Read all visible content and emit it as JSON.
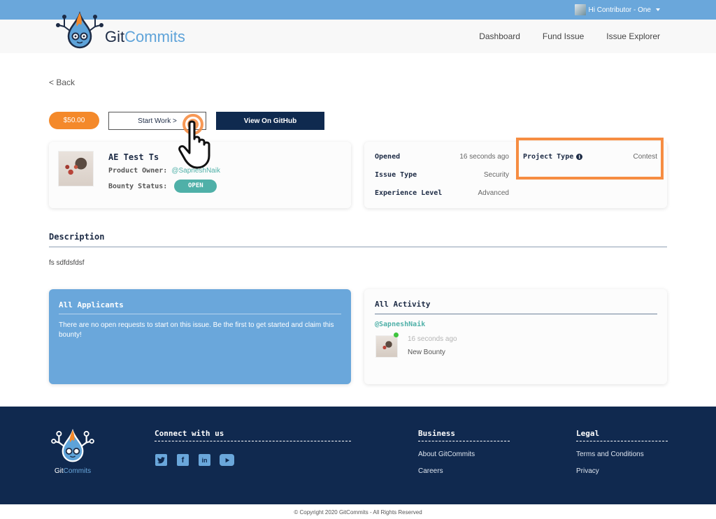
{
  "topbar": {
    "user_greeting": "Hi Contributor - One",
    "icons": {
      "avatar": "user-avatar",
      "caret": "caret-down-icon"
    }
  },
  "brand": {
    "name_part1": "Git",
    "name_part2": "Commits",
    "logo_icon": "gitcommits-mascot-logo"
  },
  "nav": {
    "items": [
      {
        "label": "Dashboard"
      },
      {
        "label": "Fund Issue"
      },
      {
        "label": "Issue Explorer"
      }
    ]
  },
  "back_label": "< Back",
  "actions": {
    "bounty_amount": "$50.00",
    "start_work_label": "Start Work >",
    "view_github_label": "View On GitHub"
  },
  "issue": {
    "title": "AE Test Ts",
    "owner_label": "Product Owner:",
    "owner": "@SapneshNaik",
    "status_label": "Bounty Status:",
    "status": "OPEN"
  },
  "meta": {
    "opened_label": "Opened",
    "opened_value": "16 seconds ago",
    "issue_type_label": "Issue Type",
    "issue_type_value": "Security",
    "experience_label": "Experience Level",
    "experience_value": "Advanced",
    "project_type_label": "Project Type",
    "project_type_value": "Contest",
    "info_icon": "info-icon"
  },
  "description": {
    "title": "Description",
    "text": "fs sdfdsfdsf"
  },
  "applicants": {
    "title": "All Applicants",
    "empty_text": "There are no open requests to start on this issue. Be the first to get started and claim this bounty!"
  },
  "activity": {
    "title": "All Activity",
    "items": [
      {
        "user": "@SapneshNaik",
        "time": "16 seconds ago",
        "action": "New Bounty"
      }
    ]
  },
  "footer": {
    "brand_part1": "Git",
    "brand_part2": "Commits",
    "connect_title": "Connect with us",
    "social": [
      "twitter-icon",
      "facebook-icon",
      "linkedin-icon",
      "youtube-icon"
    ],
    "business_title": "Business",
    "business_links": [
      "About GitCommits",
      "Careers"
    ],
    "legal_title": "Legal",
    "legal_links": [
      "Terms and Conditions",
      "Privacy"
    ],
    "copyright": "© Copyright 2020 GitCommits - All Rights Reserved"
  },
  "colors": {
    "topbar": "#6aa7db",
    "accent_orange": "#f4892a",
    "navy": "#0f2a4f",
    "teal": "#4fb0a8",
    "highlight_box": "#f68d42"
  }
}
